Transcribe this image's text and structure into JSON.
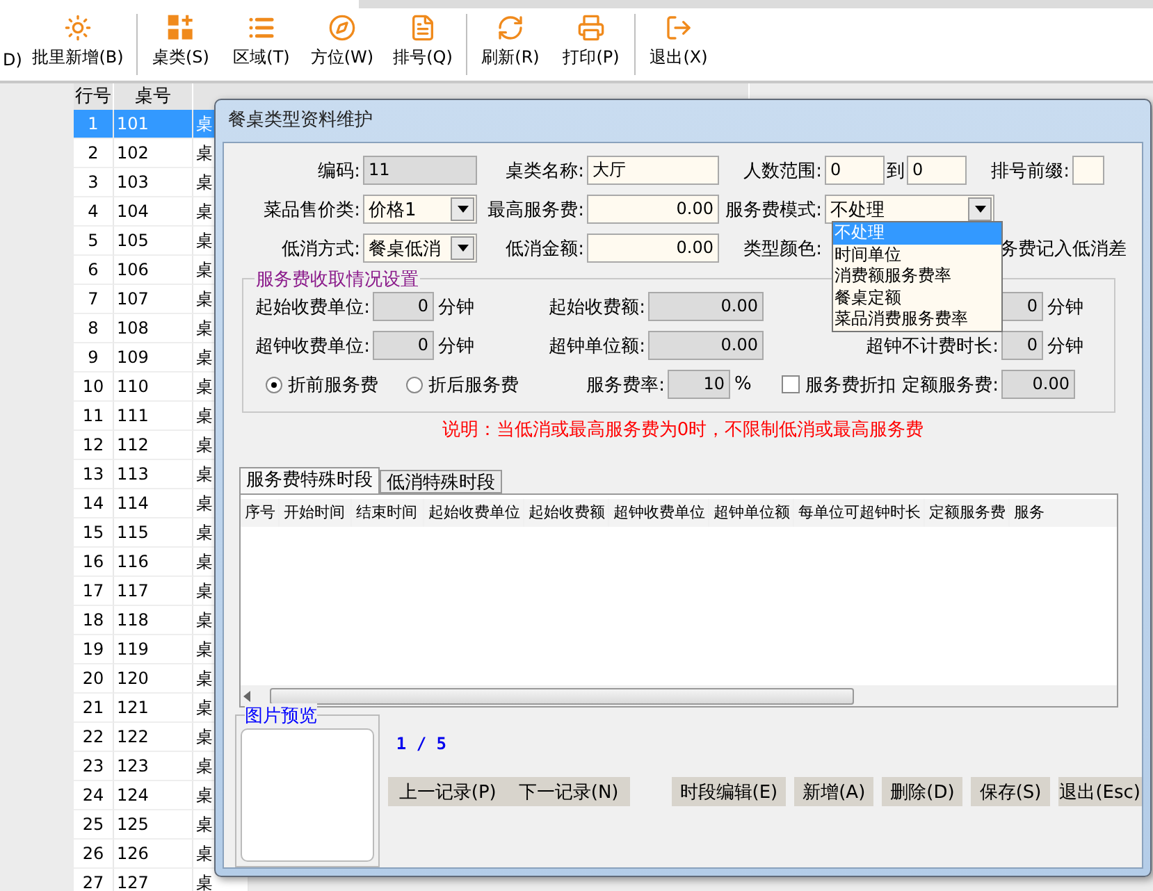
{
  "toolbar": {
    "groups": [
      [
        {
          "label": "D)",
          "kind": "cut"
        },
        {
          "label": "批里新增(B)",
          "kind": "sun"
        }
      ],
      [
        {
          "label": "桌类(S)",
          "kind": "grid-plus"
        },
        {
          "label": "区域(T)",
          "kind": "list"
        },
        {
          "label": "方位(W)",
          "kind": "compass"
        },
        {
          "label": "排号(Q)",
          "kind": "document"
        }
      ],
      [
        {
          "label": "刷新(R)",
          "kind": "refresh"
        },
        {
          "label": "打印(P)",
          "kind": "printer"
        }
      ],
      [
        {
          "label": "退出(X)",
          "kind": "exit"
        }
      ]
    ]
  },
  "table": {
    "columns": [
      "行号",
      "桌号"
    ],
    "rows": [
      {
        "row_no": "1",
        "table_no": "101",
        "name": "桌",
        "selected": true
      },
      {
        "row_no": "2",
        "table_no": "102",
        "name": "桌",
        "selected": false
      },
      {
        "row_no": "3",
        "table_no": "103",
        "name": "桌",
        "selected": false
      },
      {
        "row_no": "4",
        "table_no": "104",
        "name": "桌",
        "selected": false
      },
      {
        "row_no": "5",
        "table_no": "105",
        "name": "桌",
        "selected": false
      },
      {
        "row_no": "6",
        "table_no": "106",
        "name": "桌",
        "selected": false
      },
      {
        "row_no": "7",
        "table_no": "107",
        "name": "桌",
        "selected": false
      },
      {
        "row_no": "8",
        "table_no": "108",
        "name": "桌",
        "selected": false
      },
      {
        "row_no": "9",
        "table_no": "109",
        "name": "桌",
        "selected": false
      },
      {
        "row_no": "10",
        "table_no": "110",
        "name": "桌",
        "selected": false
      },
      {
        "row_no": "11",
        "table_no": "111",
        "name": "桌",
        "selected": false
      },
      {
        "row_no": "12",
        "table_no": "112",
        "name": "桌",
        "selected": false
      },
      {
        "row_no": "13",
        "table_no": "113",
        "name": "桌",
        "selected": false
      },
      {
        "row_no": "14",
        "table_no": "114",
        "name": "桌",
        "selected": false
      },
      {
        "row_no": "15",
        "table_no": "115",
        "name": "桌",
        "selected": false
      },
      {
        "row_no": "16",
        "table_no": "116",
        "name": "桌",
        "selected": false
      },
      {
        "row_no": "17",
        "table_no": "117",
        "name": "桌",
        "selected": false
      },
      {
        "row_no": "18",
        "table_no": "118",
        "name": "桌",
        "selected": false
      },
      {
        "row_no": "19",
        "table_no": "119",
        "name": "桌",
        "selected": false
      },
      {
        "row_no": "20",
        "table_no": "120",
        "name": "桌",
        "selected": false
      },
      {
        "row_no": "21",
        "table_no": "121",
        "name": "桌",
        "selected": false
      },
      {
        "row_no": "22",
        "table_no": "122",
        "name": "桌",
        "selected": false
      },
      {
        "row_no": "23",
        "table_no": "123",
        "name": "桌",
        "selected": false
      },
      {
        "row_no": "24",
        "table_no": "124",
        "name": "桌",
        "selected": false
      },
      {
        "row_no": "25",
        "table_no": "125",
        "name": "桌",
        "selected": false
      },
      {
        "row_no": "26",
        "table_no": "126",
        "name": "桌",
        "selected": false
      },
      {
        "row_no": "27",
        "table_no": "127",
        "name": "桌",
        "selected": false
      }
    ]
  },
  "dialog": {
    "title": "餐桌类型资料维护",
    "fields": [
      [
        {
          "kind": "text",
          "label": "编码:",
          "value": "11",
          "disabled": true
        },
        {
          "kind": "text",
          "label": "桌类名称:",
          "value": "大厅",
          "disabled": false
        },
        {
          "kind": "range",
          "label": "人数范围:",
          "from": "0",
          "to_label": "到",
          "to": "0"
        },
        {
          "kind": "text",
          "label": "排号前缀:",
          "disabled": false
        }
      ],
      [
        {
          "kind": "select",
          "label": "菜品售价类:",
          "value": "价格1"
        },
        {
          "kind": "number",
          "label": "最高服务费:",
          "value": "0.00",
          "disabled": false
        },
        {
          "kind": "select",
          "label": "服务费模式:",
          "value": "不处理",
          "open": true,
          "options": [
            {
              "label": "不处理",
              "selected": true
            },
            {
              "label": "时间单位",
              "selected": false
            },
            {
              "label": "消费额服务费率",
              "selected": false
            },
            {
              "label": "餐桌定额",
              "selected": false
            },
            {
              "label": "菜品消费服务费率",
              "selected": false
            }
          ]
        }
      ],
      [
        {
          "kind": "select",
          "label": "低消方式:",
          "value": "餐桌低消"
        },
        {
          "kind": "number",
          "label": "低消金额:",
          "value": "0.00",
          "disabled": false
        },
        {
          "kind": "color",
          "label": "类型颜色:"
        },
        {
          "kind": "note",
          "label": "务费记入低消差"
        }
      ]
    ],
    "group": {
      "title": "服务费收取情况设置",
      "rows": [
        [
          {
            "label": "起始收费单位:",
            "value": "0",
            "unit": "分钟"
          },
          {
            "label": "起始收费额:",
            "value": "0.00"
          },
          {
            "value": "0",
            "unit": "分钟"
          }
        ],
        [
          {
            "label": "超钟收费单位:",
            "value": "0",
            "unit": "分钟"
          },
          {
            "label": "超钟单位额:",
            "value": "0.00"
          },
          {
            "label": "超钟不计费时长:",
            "value": "0",
            "unit": "分钟"
          }
        ]
      ],
      "radios": [
        {
          "label": "折前服务费",
          "selected": true
        },
        {
          "label": "折后服务费",
          "selected": false
        }
      ],
      "rate": {
        "label": "服务费率:",
        "value": "10",
        "unit": "%"
      },
      "discount": {
        "label": "服务费折扣",
        "checked": false
      },
      "fixed": {
        "label": "定额服务费:",
        "value": "0.00"
      }
    },
    "note": "说明：当低消或最高服务费为0时，不限制低消或最高服务费",
    "tabs": [
      {
        "label": "服务费特殊时段",
        "selected": true
      },
      {
        "label": "低消特殊时段",
        "selected": false
      }
    ],
    "grid_columns": [
      "序号",
      "开始时间",
      "结束时间",
      "起始收费单位",
      "起始收费额",
      "超钟收费单位",
      "超钟单位额",
      "每单位可超钟时长",
      "定额服务费",
      "服务"
    ],
    "preview": {
      "title": "图片预览"
    },
    "pager": "1 / 5",
    "nav_buttons": [
      "上一记录(P)",
      "下一记录(N)"
    ],
    "action_buttons": [
      "时段编辑(E)",
      "新增(A)",
      "删除(D)",
      "保存(S)",
      "退出(Esc)"
    ]
  }
}
